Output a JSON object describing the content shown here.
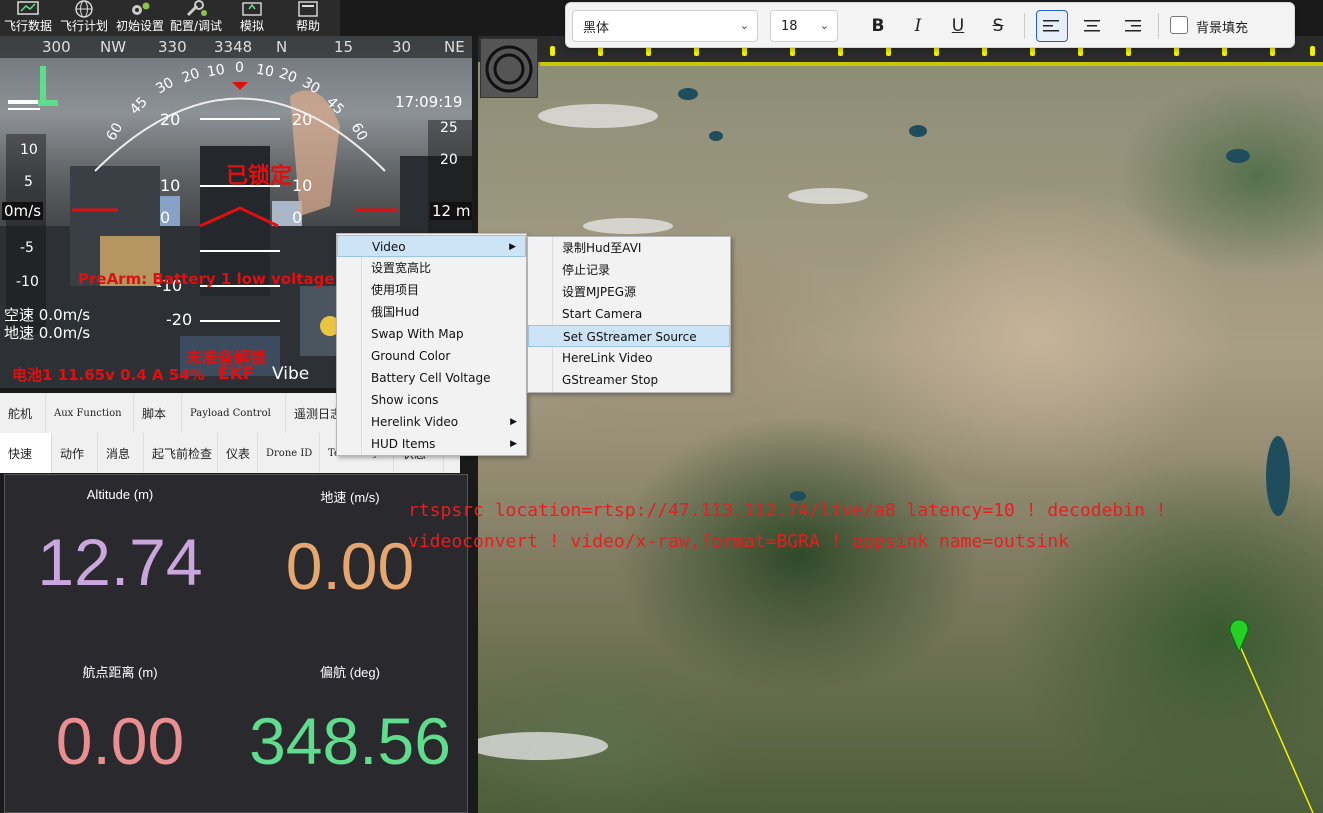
{
  "menubar": {
    "items": [
      {
        "label": "飞行数据",
        "icon": "flight-data-icon"
      },
      {
        "label": "飞行计划",
        "icon": "globe-icon"
      },
      {
        "label": "初始设置",
        "icon": "gears-icon"
      },
      {
        "label": "配置/调试",
        "icon": "wrench-icon"
      },
      {
        "label": "模拟",
        "icon": "simulation-icon"
      },
      {
        "label": "帮助",
        "icon": "help-icon"
      }
    ]
  },
  "hud": {
    "heading_ticks": [
      "300",
      "NW",
      "330",
      "3348",
      "N",
      "15",
      "30",
      "NE"
    ],
    "pitch_labels": [
      "60",
      "45",
      "30",
      "20",
      "10",
      "0",
      "10",
      "20",
      "30",
      "45",
      "60"
    ],
    "ladder_left": [
      "20",
      "10",
      "0",
      "-10",
      "-20"
    ],
    "ladder_right": [
      "20",
      "10",
      "0"
    ],
    "clock": "17:09:19",
    "locked_label": "已锁定",
    "speed_readout": "0m/s",
    "speed_ticks": [
      "10",
      "5",
      "-5",
      "-10"
    ],
    "alt_readout": "12 m",
    "alt_ticks": [
      "25",
      "20"
    ],
    "prearm_warning": "PreArm: Battery 1 low voltage",
    "airspeed": "空速 0.0m/s",
    "groundspeed": "地速 0.0m/s",
    "not_ready": "未准备解锁",
    "battery": "电池1 11.65v 0.4 A 54%",
    "ekf": "EKF",
    "vibe": "Vibe"
  },
  "tabs_row1": [
    "舵机",
    "Aux Function",
    "脚本",
    "Payload Control",
    "遥测日志"
  ],
  "tabs_row2": [
    "快速",
    "动作",
    "消息",
    "起飞前检查",
    "仪表",
    "Drone ID",
    "Telemetry",
    "状态"
  ],
  "quick": {
    "cells": [
      {
        "label": "Altitude (m)",
        "value": "12.74",
        "color": "#c9a6dd"
      },
      {
        "label": "地速 (m/s)",
        "value": "0.00",
        "color": "#e5a76f"
      },
      {
        "label": "航点距离 (m)",
        "value": "0.00",
        "color": "#e98f92"
      },
      {
        "label": "偏航 (deg)",
        "value": "348.56",
        "color": "#5fdc8c"
      }
    ]
  },
  "toolbar": {
    "font_family": "黑体",
    "font_size": "18",
    "bold": "B",
    "italic": "I",
    "underline": "U",
    "strikethrough": "S",
    "fill_label": "背景填充"
  },
  "overlay": {
    "line1": "rtspsrc location=rtsp://47.113.112.74/live/a8 latency=10 ! decodebin !",
    "line2": "videoconvert ! video/x-raw,format=BGRA ! appsink name=outsink"
  },
  "context_menu": {
    "items": [
      {
        "label": "Video",
        "submenu": true,
        "highlighted": true
      },
      {
        "label": "设置宽高比",
        "submenu": false
      },
      {
        "label": "使用项目",
        "submenu": false
      },
      {
        "label": "俄国Hud",
        "submenu": false
      },
      {
        "label": "Swap With Map",
        "submenu": false
      },
      {
        "label": "Ground Color",
        "submenu": false
      },
      {
        "label": "Battery Cell Voltage",
        "submenu": false
      },
      {
        "label": "Show icons",
        "submenu": false
      },
      {
        "label": "Herelink Video",
        "submenu": true
      },
      {
        "label": "HUD Items",
        "submenu": true
      }
    ]
  },
  "submenu": {
    "items": [
      {
        "label": "录制Hud至AVI",
        "highlighted": false
      },
      {
        "label": "停止记录",
        "highlighted": false
      },
      {
        "label": "设置MJPEG源",
        "highlighted": false
      },
      {
        "label": "Start Camera",
        "highlighted": false
      },
      {
        "label": "Set GStreamer Source",
        "highlighted": true
      },
      {
        "label": "HereLink Video",
        "highlighted": false
      },
      {
        "label": "GStreamer Stop",
        "highlighted": false
      }
    ]
  },
  "colors": {
    "accent_red": "#e01010",
    "highlight": "#cde3f6",
    "ruler_yellow": "#c9c800"
  }
}
